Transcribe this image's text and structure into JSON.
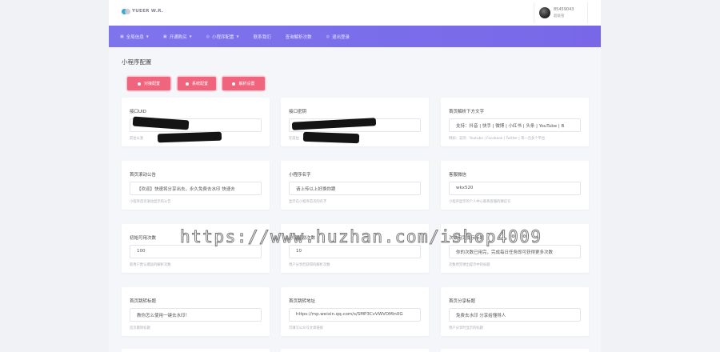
{
  "header": {
    "logo_text": "YUEER W.R.",
    "user_name": "85459043",
    "user_role": "超级管"
  },
  "nav": {
    "items": [
      {
        "icon": "▣",
        "label": "全局信息",
        "has_dropdown": true
      },
      {
        "icon": "▣",
        "label": "开通购买",
        "has_dropdown": true
      },
      {
        "icon": "◎",
        "label": "小程序配置",
        "has_dropdown": true
      },
      {
        "icon": "",
        "label": "联系我们",
        "has_dropdown": false
      },
      {
        "icon": "",
        "label": "查询解析次数",
        "has_dropdown": false
      },
      {
        "icon": "◎",
        "label": "退出登录",
        "has_dropdown": false
      }
    ]
  },
  "page_title": "小程序配置",
  "buttons": {
    "b1": "对接配置",
    "b2": "系统配置",
    "b3": "解析设置"
  },
  "cards": {
    "c1": {
      "label": "接口UID",
      "value": "",
      "help": "前往以查"
    },
    "c2": {
      "label": "接口密钥",
      "value": "",
      "help": "在前往"
    },
    "c3": {
      "label": "首页解析下方文字",
      "value": "支持：抖音 | 快手 | 微博 | 小红书 | 头条 | YouTube | B",
      "help": "例如：支持：Youtube | Facebook | Twitter | 等一百多个平台"
    },
    "c4": {
      "label": "首页滚动公告",
      "value": "【欢迎】快速将分享出去，永久免费去水印 快速去",
      "help": "小程序首页滚动显示的公告"
    },
    "c5": {
      "label": "小程序名字",
      "value": "请上传以上好换你跟",
      "help": "显示在小程序首页的名字"
    },
    "c6": {
      "label": "客服微信",
      "value": "wkx520",
      "help": "小程序显示的个人中心联系客服的微信号"
    },
    "c7": {
      "label": "初始可用次数",
      "value": "100",
      "help": "新用户默认赠送的解析次数"
    },
    "c8": {
      "label": "分享奖励次数",
      "value": "10",
      "help": "用户分享后获得的解析次数"
    },
    "c9": {
      "label": "次数用完提示标题",
      "value": "你的次数已用完，完成每日任务即可获得更多次数",
      "help": "次数用完弹出提示中的标题"
    },
    "c10": {
      "label": "首页跳转标题",
      "value": "教你怎么使用一键去水印！",
      "help": "首页跳转标题"
    },
    "c11": {
      "label": "首页跳转地址",
      "value": "https://mp.weixin.qq.com/s/SMP3CvVWVOMin0G",
      "help": "可填写公众号文章链接"
    },
    "c12": {
      "label": "首页分享标题",
      "value": "免费去水印 分享给懂得人",
      "help": "用户分享时显示的标题"
    }
  },
  "watermark": "https://www.huzhan.com/ishop4009"
}
